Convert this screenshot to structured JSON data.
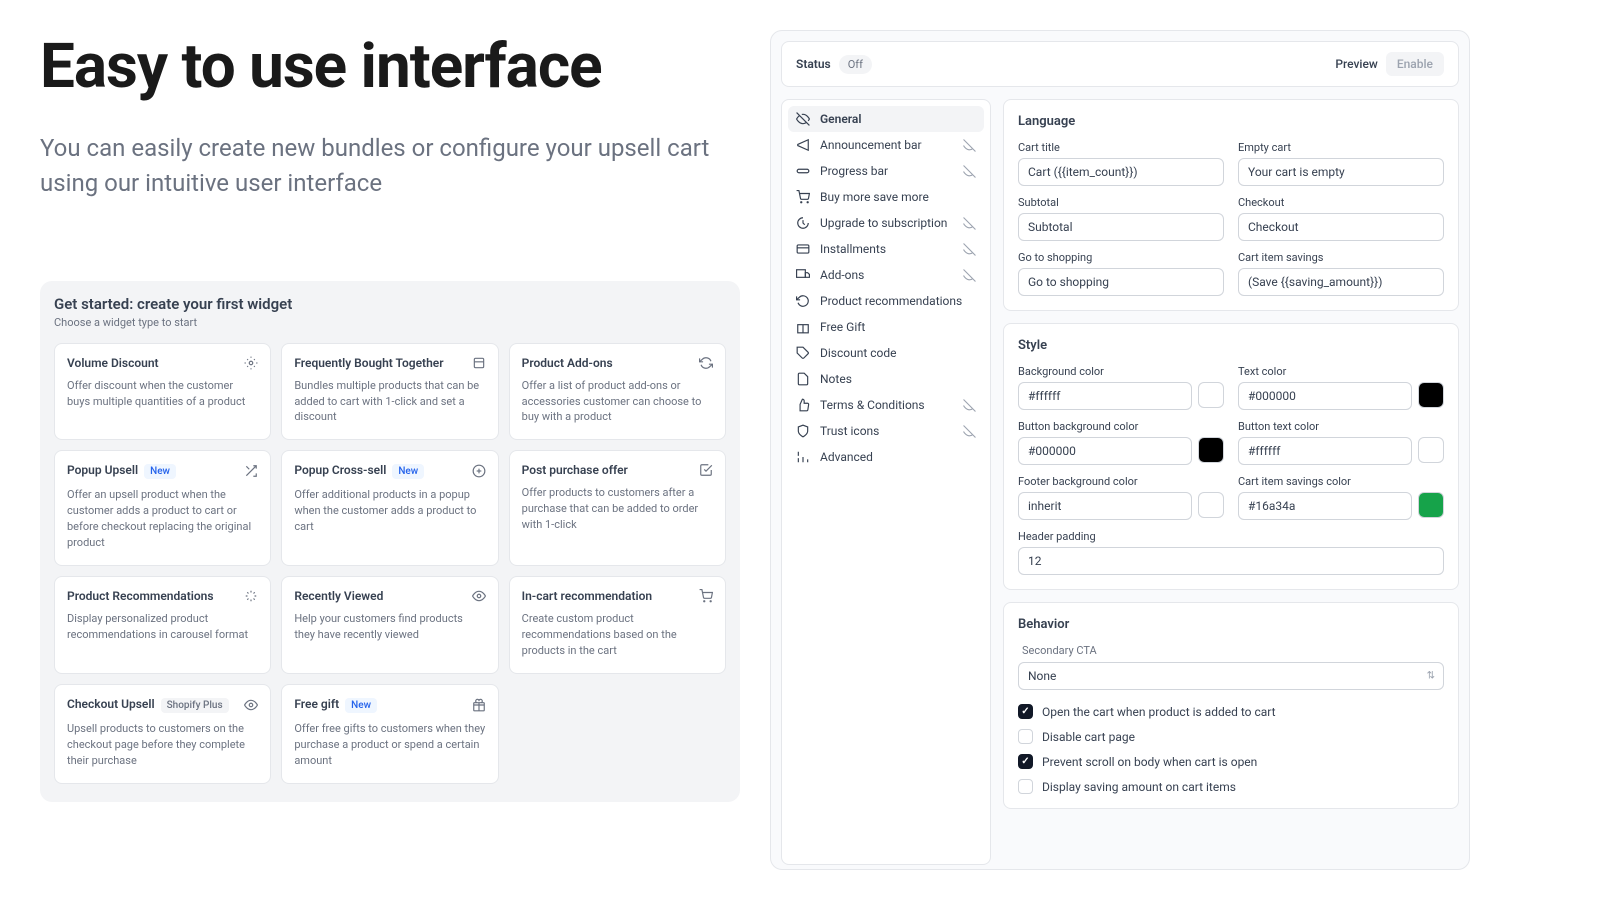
{
  "hero": {
    "title": "Easy to use interface",
    "subtitle": "You can easily create new bundles or configure your upsell cart using our intuitive user interface"
  },
  "panel": {
    "title": "Get started: create your first widget",
    "subtitle": "Choose a widget type to start"
  },
  "widgets": {
    "w0": {
      "title": "Volume Discount",
      "desc": "Offer discount when the customer buys multiple quantities of a product"
    },
    "w1": {
      "title": "Frequently Bought Together",
      "desc": "Bundles multiple products that can be added to cart with 1-click and set a discount"
    },
    "w2": {
      "title": "Product Add-ons",
      "desc": "Offer a list of product add-ons or accessories customer can choose to buy with a product"
    },
    "w3": {
      "title": "Popup Upsell",
      "badge": "New",
      "desc": "Offer an upsell product when the customer adds a product to cart or before checkout replacing the original product"
    },
    "w4": {
      "title": "Popup Cross-sell",
      "badge": "New",
      "desc": "Offer additional products in a popup when the customer adds a product to cart"
    },
    "w5": {
      "title": "Post purchase offer",
      "desc": "Offer products to customers after a purchase that can be added to order with 1-click"
    },
    "w6": {
      "title": "Product Recommendations",
      "desc": "Display personalized product recommendations in carousel format"
    },
    "w7": {
      "title": "Recently Viewed",
      "desc": "Help your customers find products they have recently viewed"
    },
    "w8": {
      "title": "In-cart recommendation",
      "desc": "Create custom product recommendations based on the products in the cart"
    },
    "w9": {
      "title": "Checkout Upsell",
      "badge": "Shopify Plus",
      "desc": "Upsell products to customers on the checkout page before they complete their purchase"
    },
    "w10": {
      "title": "Free gift",
      "badge": "New",
      "desc": "Offer free gifts to customers when they purchase a product or spend a certain amount"
    }
  },
  "config": {
    "status_label": "Status",
    "status_value": "Off",
    "preview": "Preview",
    "enable": "Enable"
  },
  "nav": {
    "n0": "General",
    "n1": "Announcement bar",
    "n2": "Progress bar",
    "n3": "Buy more save more",
    "n4": "Upgrade to subscription",
    "n5": "Installments",
    "n6": "Add-ons",
    "n7": "Product recommendations",
    "n8": "Free Gift",
    "n9": "Discount code",
    "n10": "Notes",
    "n11": "Terms & Conditions",
    "n12": "Trust icons",
    "n13": "Advanced"
  },
  "lang": {
    "title": "Language",
    "cart_title_lbl": "Cart title",
    "cart_title_val": "Cart ({{item_count}})",
    "empty_lbl": "Empty cart",
    "empty_val": "Your cart is empty",
    "subtotal_lbl": "Subtotal",
    "subtotal_val": "Subtotal",
    "checkout_lbl": "Checkout",
    "checkout_val": "Checkout",
    "goto_lbl": "Go to shopping",
    "goto_val": "Go to shopping",
    "savings_lbl": "Cart item savings",
    "savings_val": "(Save {{saving_amount}})"
  },
  "style": {
    "title": "Style",
    "bg_lbl": "Background color",
    "bg_val": "#ffffff",
    "txt_lbl": "Text color",
    "txt_val": "#000000",
    "btnbg_lbl": "Button background color",
    "btnbg_val": "#000000",
    "btntxt_lbl": "Button text color",
    "btntxt_val": "#ffffff",
    "footer_lbl": "Footer background color",
    "footer_val": "inherit",
    "savings_lbl": "Cart item savings color",
    "savings_val": "#16a34a",
    "pad_lbl": "Header padding",
    "pad_val": "12"
  },
  "behavior": {
    "title": "Behavior",
    "cta_lbl": "Secondary CTA",
    "cta_val": "None",
    "cb0": "Open the cart when product is added to cart",
    "cb1": "Disable cart page",
    "cb2": "Prevent scroll on body when cart is open",
    "cb3": "Display saving amount on cart items"
  }
}
